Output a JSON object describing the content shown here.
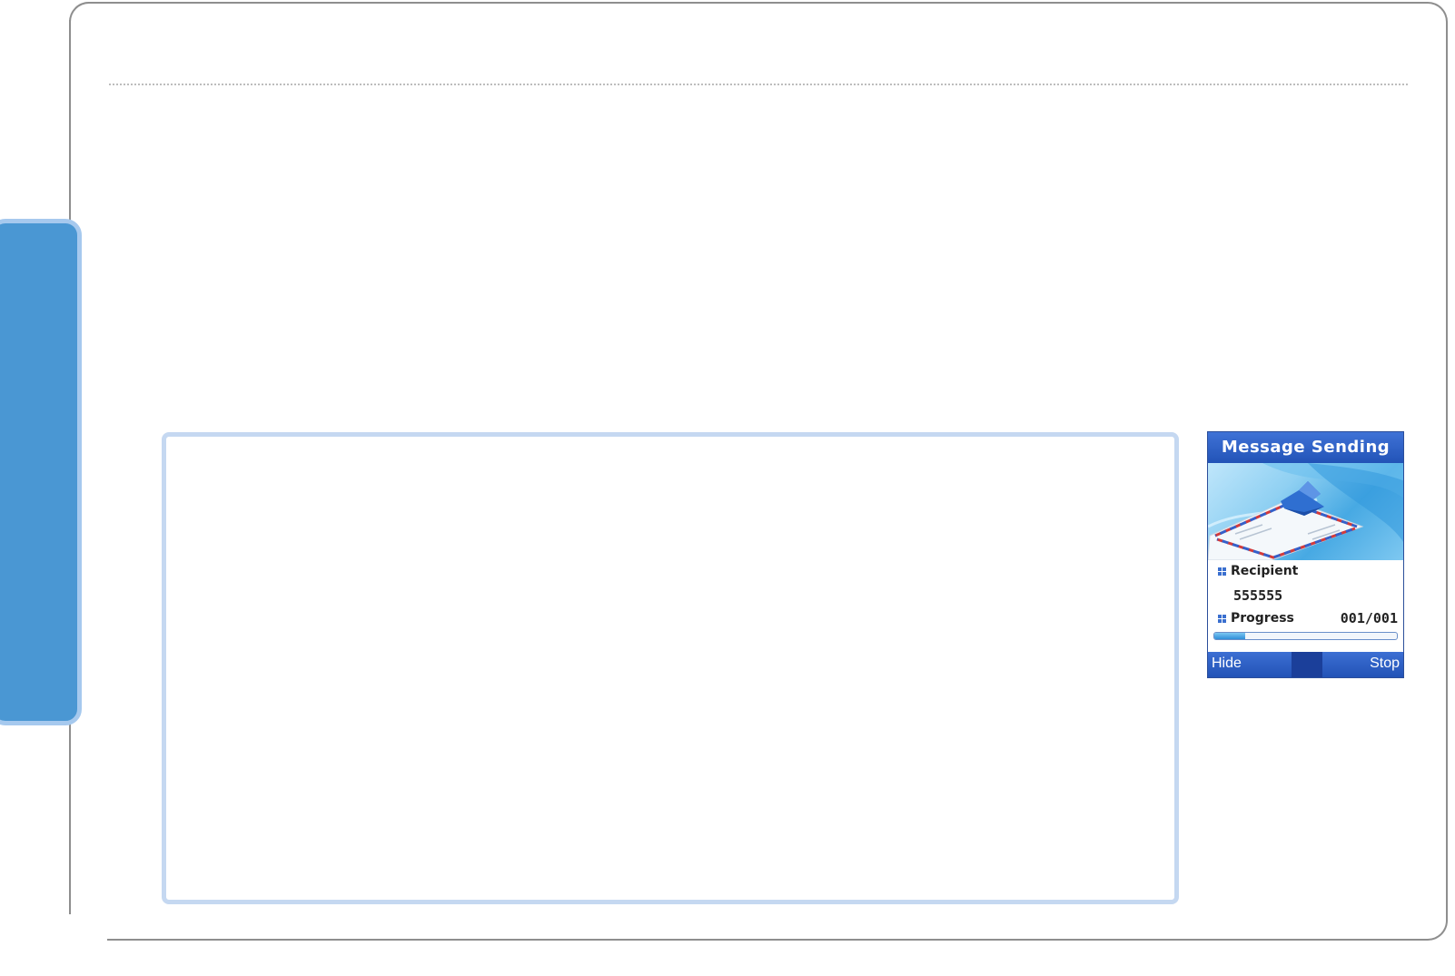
{
  "phone_screen": {
    "title": "Message Sending",
    "recipient_label": "Recipient",
    "recipient_value": "555555",
    "progress_label": "Progress",
    "progress_value": "001/001",
    "progress_fraction": 0.17,
    "softkeys": {
      "left": "Hide",
      "right": "Stop"
    },
    "graphic": "envelope-sending-icon"
  },
  "colors": {
    "side_tab": "#4a97d3",
    "side_tab_border": "#a6c9ee",
    "content_box_border": "#c5d8f1",
    "phone_bar": "#2253b7"
  }
}
